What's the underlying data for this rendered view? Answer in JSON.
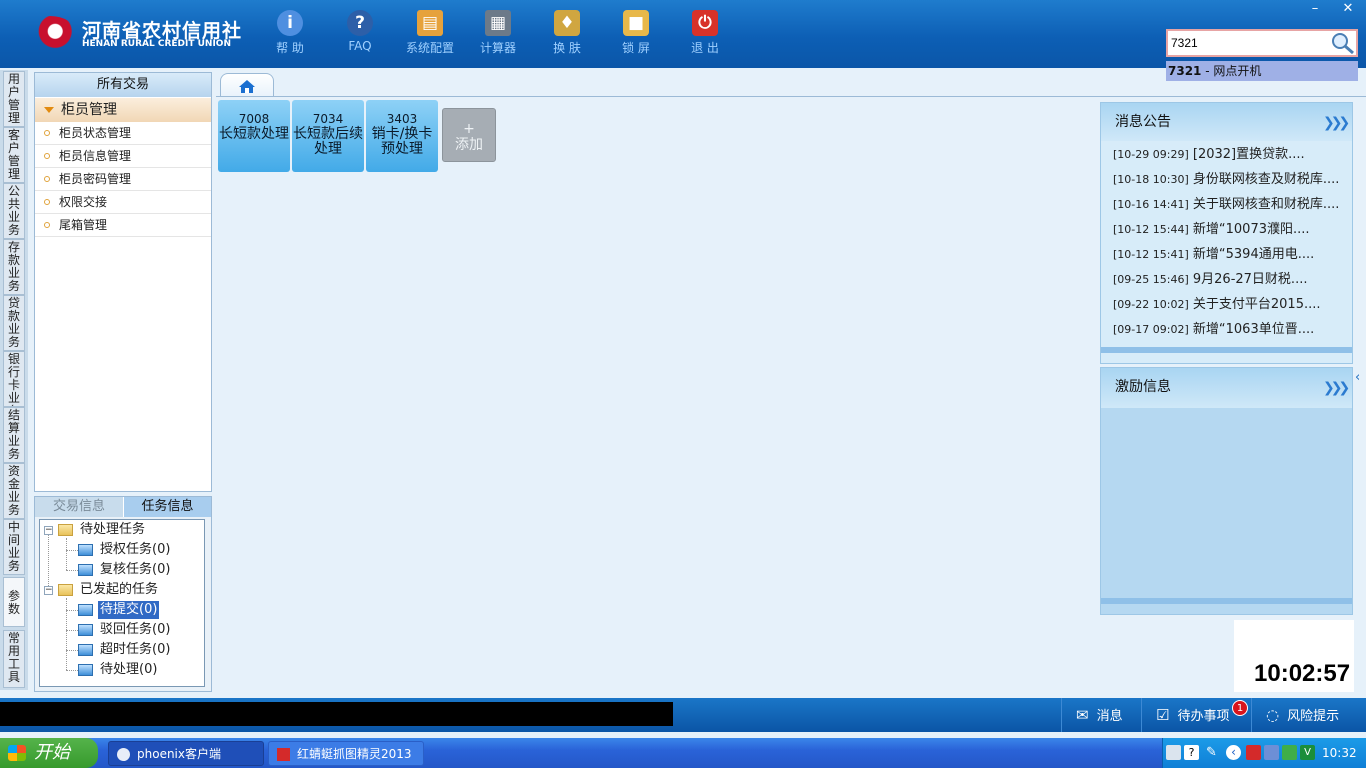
{
  "header": {
    "logo_cn": "河南省农村信用社",
    "logo_en": "HENAN RURAL CREDIT UNION",
    "tools": [
      {
        "icon": "info-icon",
        "label": "帮 助",
        "color": "#4f8fe0"
      },
      {
        "icon": "faq-icon",
        "label": "FAQ",
        "color": "#2d5fa8"
      },
      {
        "icon": "toolbox-icon",
        "label": "系统配置",
        "color": "#e6a23c"
      },
      {
        "icon": "calculator-icon",
        "label": "计算器",
        "color": "#6c7a89"
      },
      {
        "icon": "shirt-icon",
        "label": "换 肤",
        "color": "#d0a640"
      },
      {
        "icon": "lock-icon",
        "label": "锁 屏",
        "color": "#e8b84a"
      },
      {
        "icon": "power-icon",
        "label": "退 出",
        "color": "#d8322a"
      }
    ],
    "window_controls": {
      "minimize": "–",
      "close": "✕"
    },
    "search": {
      "value": "7321",
      "suggest_code": "7321",
      "suggest_text": " - 网点开机"
    }
  },
  "vtabs": [
    {
      "label": "用户管理"
    },
    {
      "label": "客户管理"
    },
    {
      "label": "公共业务"
    },
    {
      "label": "存款业务"
    },
    {
      "label": "贷款业务"
    },
    {
      "label": "银行卡业务"
    },
    {
      "label": "结算业务"
    },
    {
      "label": "资金业务"
    },
    {
      "label": "中间业务"
    },
    {
      "label": "参数"
    },
    {
      "label": "常用工具"
    }
  ],
  "menu": {
    "title": "所有交易",
    "group": "柜员管理",
    "items": [
      "柜员状态管理",
      "柜员信息管理",
      "柜员密码管理",
      "权限交接",
      "尾箱管理"
    ]
  },
  "task_panel": {
    "tabs": [
      "交易信息",
      "任务信息"
    ],
    "active_tab": "任务信息",
    "tree": {
      "pending": {
        "label": "待处理任务",
        "children": [
          "授权任务(0)",
          "复核任务(0)"
        ]
      },
      "initiated": {
        "label": "已发起的任务",
        "children": [
          "待提交(0)",
          "驳回任务(0)",
          "超时任务(0)",
          "待处理(0)"
        ]
      },
      "selected": "待提交(0)"
    }
  },
  "quick_tiles": [
    {
      "code": "7008",
      "name": "长短款处理"
    },
    {
      "code": "7034",
      "name": "长短款后续处理"
    },
    {
      "code": "3403",
      "name": "销卡/换卡预处理"
    }
  ],
  "add_tile": {
    "plus": "+",
    "label": "添加"
  },
  "notices": {
    "title": "消息公告",
    "items": [
      {
        "time": "[10-29 09:29]",
        "text": "[2032]置换贷款...."
      },
      {
        "time": "[10-18 10:30]",
        "text": "身份联网核查及财税库...."
      },
      {
        "time": "[10-16 14:41]",
        "text": "关于联网核查和财税库...."
      },
      {
        "time": "[10-12 15:44]",
        "text": "新增“10073濮阳...."
      },
      {
        "time": "[10-12 15:41]",
        "text": "新增“5394通用电...."
      },
      {
        "time": "[09-25 15:46]",
        "text": "9月26-27日财税...."
      },
      {
        "time": "[09-22 10:02]",
        "text": "关于支付平台2015...."
      },
      {
        "time": "[09-17 09:02]",
        "text": "新增“1063单位晋...."
      }
    ]
  },
  "reward": {
    "title": "激励信息"
  },
  "clock": "10:02:57",
  "statusbar": {
    "message": "消息",
    "todo": "待办事项",
    "todo_badge": "1",
    "risk": "风险提示"
  },
  "taskbar": {
    "start": "开始",
    "tasks": [
      "phoenix客户端",
      "红蜻蜓抓图精灵2013"
    ],
    "time": "10:32"
  }
}
